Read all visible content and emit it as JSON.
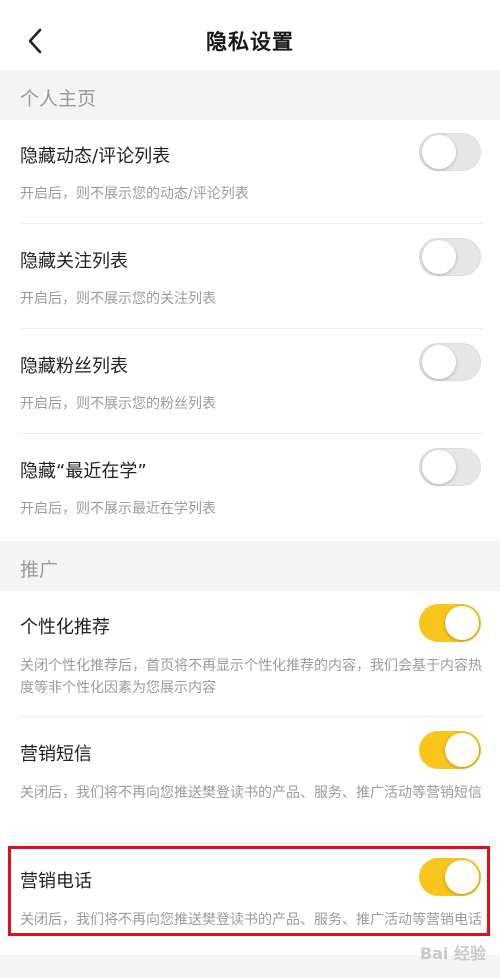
{
  "header": {
    "title": "隐私设置"
  },
  "sections": [
    {
      "label": "个人主页"
    },
    {
      "label": "推广"
    }
  ],
  "rows": [
    {
      "title": "隐藏动态/评论列表",
      "desc": "开启后，则不展示您的动态/评论列表",
      "on": false
    },
    {
      "title": "隐藏关注列表",
      "desc": "开启后，则不展示您的关注列表",
      "on": false
    },
    {
      "title": "隐藏粉丝列表",
      "desc": "开启后，则不展示您的粉丝列表",
      "on": false
    },
    {
      "title": "隐藏“最近在学”",
      "desc": "开启后，则不展示最近在学列表",
      "on": false
    },
    {
      "title": "个性化推荐",
      "desc": "关闭个性化推荐后，首页将不再显示个性化推荐的内容，我们会基于内容热度等非个性化因素为您展示内容",
      "on": true
    },
    {
      "title": "营销短信",
      "desc": "关闭后，我们将不再向您推送樊登读书的产品、服务、推广活动等营销短信",
      "on": true
    },
    {
      "title": "营销电话",
      "desc": "关闭后，我们将不再向您推送樊登读书的产品、服务、推广活动等营销电话",
      "on": true
    }
  ],
  "colors": {
    "accent": "#f7c51b",
    "highlight": "#e0101a"
  },
  "watermark": "Bai 经验"
}
